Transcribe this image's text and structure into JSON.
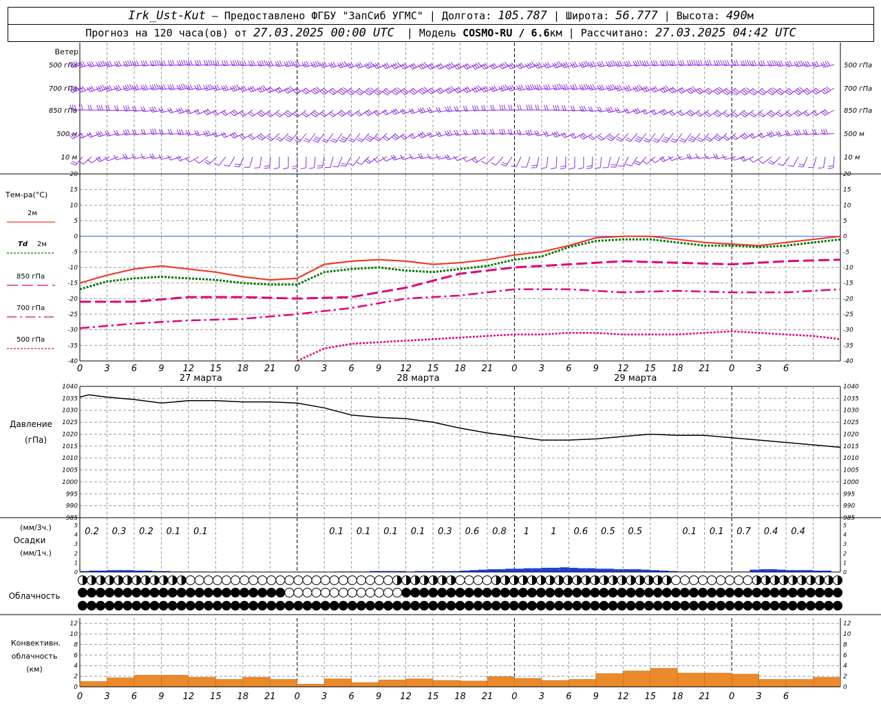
{
  "header": {
    "station": "Irk_Ust-Kut",
    "provided": "– Предоставлено ФГБУ \"ЗапСиб УГМС\"",
    "lon_label": "Долгота:",
    "lon": "105.787",
    "lat_label": "Широта:",
    "lat": "56.777",
    "alt_label": "Высота:",
    "alt": "490",
    "alt_unit": "м",
    "forecast_label": "Прогноз на 120 часа(ов) от",
    "forecast_from": "27.03.2025 00:00 UTC",
    "model_label": "Модель",
    "model": "COSMO-RU / 6.6",
    "model_unit": "км",
    "calc_label": "Рассчитано:",
    "calc_time": "27.03.2025 04:42 UTC"
  },
  "colors": {
    "t2m": "#ee3a2c",
    "td2m": "#007700",
    "t850": "#e0007a",
    "t700": "#e0007a",
    "t500": "#e0007a",
    "barb": "#8a2be2",
    "precip": "#1f3fd6",
    "conv": "#ea8a2a",
    "pressure": "#000000",
    "zero_line": "#3355ff",
    "grid": "#999999"
  },
  "hour_ticks": [
    "0",
    "3",
    "6",
    "9",
    "12",
    "15",
    "18",
    "21",
    "0",
    "3",
    "6",
    "9",
    "12",
    "15",
    "18",
    "21",
    "0",
    "3",
    "6",
    "9",
    "12",
    "15",
    "18",
    "21",
    "0",
    "3",
    "6"
  ],
  "day_labels": [
    "27 марта",
    "28 марта",
    "29 марта"
  ],
  "wind": {
    "title": "Ветер",
    "levels": [
      "500 гПа",
      "700 гПа",
      "850 гПа",
      "500 м",
      "10 м"
    ],
    "levels_right": [
      "500 гПа",
      "700 гПа",
      "850 гПа",
      "500 м",
      "10 м"
    ]
  },
  "temperature": {
    "title": "Тем-ра(°С)",
    "legend": [
      "2м",
      "Td 2м",
      "850 гПа",
      "700 гПа",
      "500 гПа"
    ]
  },
  "pressure_panel": {
    "title": "Давление",
    "unit": "(гПа)"
  },
  "precip_panel": {
    "unit3": "(мм/3ч.)",
    "title": "Осадки",
    "unit1": "(мм/1ч.)",
    "labels": [
      {
        "h": 3,
        "v": "0.2"
      },
      {
        "h": 6,
        "v": "0.3"
      },
      {
        "h": 9,
        "v": "0.2"
      },
      {
        "h": 12,
        "v": "0.1"
      },
      {
        "h": 15,
        "v": "0.1"
      },
      {
        "h": 30,
        "v": "0.1"
      },
      {
        "h": 33,
        "v": "0.1"
      },
      {
        "h": 36,
        "v": "0.1"
      },
      {
        "h": 39,
        "v": "0.1"
      },
      {
        "h": 42,
        "v": "0.3"
      },
      {
        "h": 45,
        "v": "0.6"
      },
      {
        "h": 48,
        "v": "0.8"
      },
      {
        "h": 51,
        "v": "1"
      },
      {
        "h": 54,
        "v": "1"
      },
      {
        "h": 57,
        "v": "0.6"
      },
      {
        "h": 60,
        "v": "0.5"
      },
      {
        "h": 63,
        "v": "0.5"
      },
      {
        "h": 69,
        "v": "0.1"
      },
      {
        "h": 72,
        "v": "0.1"
      },
      {
        "h": 75,
        "v": "0.7"
      },
      {
        "h": 78,
        "v": "0.4"
      },
      {
        "h": 81,
        "v": "0.4"
      }
    ]
  },
  "cloud_panel": {
    "title": "Облачность"
  },
  "conv_panel": {
    "title1": "Конвективн.",
    "title2": "облачность",
    "unit": "(км)"
  },
  "chart_data": [
    {
      "type": "line",
      "name": "temperature",
      "x_hours": [
        0,
        6,
        12,
        18,
        24,
        30,
        36,
        42,
        48,
        54,
        60,
        66,
        72,
        78,
        84
      ],
      "ylim": [
        -40,
        20
      ],
      "yticks": [
        20,
        15,
        10,
        5,
        0,
        -5,
        -10,
        -15,
        -20,
        -25,
        -30,
        -35,
        -40
      ],
      "series": [
        {
          "name": "2м",
          "key": "t2m",
          "x": [
            0,
            3,
            6,
            9,
            12,
            15,
            18,
            21,
            24,
            27,
            30,
            33,
            36,
            39,
            42,
            45,
            48,
            51,
            54,
            57,
            60,
            63,
            66,
            69,
            72,
            75,
            78,
            81,
            84
          ],
          "values": [
            -15,
            -12.5,
            -10.5,
            -9.5,
            -10.5,
            -11.5,
            -13,
            -14,
            -13.5,
            -9,
            -8,
            -7.5,
            -8,
            -9,
            -8.5,
            -7.5,
            -6,
            -5,
            -3,
            -0.5,
            0,
            0,
            -1,
            -2,
            -2.5,
            -3,
            -2,
            -1,
            0
          ]
        },
        {
          "name": "Td 2м",
          "key": "td2m",
          "x": [
            0,
            3,
            6,
            9,
            12,
            15,
            18,
            21,
            24,
            27,
            30,
            33,
            36,
            39,
            42,
            45,
            48,
            51,
            54,
            57,
            60,
            63,
            66,
            69,
            72,
            75,
            78,
            81,
            84
          ],
          "values": [
            -17,
            -14.5,
            -13.5,
            -13,
            -13.5,
            -14,
            -15,
            -15.5,
            -15.5,
            -11.5,
            -10.5,
            -10,
            -11,
            -11.5,
            -10.5,
            -9.5,
            -7.5,
            -6.5,
            -3.5,
            -1.5,
            -1,
            -1,
            -2,
            -3,
            -3,
            -3.5,
            -3,
            -2,
            -1
          ]
        },
        {
          "name": "850 гПа",
          "key": "t850",
          "x": [
            0,
            6,
            12,
            18,
            24,
            30,
            36,
            42,
            48,
            54,
            60,
            66,
            72,
            78,
            84
          ],
          "values": [
            -21,
            -21,
            -19.5,
            -19.5,
            -20,
            -19.5,
            -16.5,
            -12,
            -10,
            -9,
            -8,
            -8.5,
            -9,
            -8,
            -7.5
          ]
        },
        {
          "name": "700 гПа",
          "key": "t700",
          "x": [
            0,
            6,
            12,
            18,
            24,
            30,
            36,
            42,
            48,
            54,
            60,
            66,
            72,
            78,
            84
          ],
          "values": [
            -29.5,
            -28,
            -27,
            -26.5,
            -25,
            -23,
            -20,
            -19,
            -17,
            -17,
            -18,
            -17.5,
            -18,
            -18,
            -17
          ]
        },
        {
          "name": "500 гПа",
          "key": "t500",
          "x": [
            24,
            27,
            30,
            33,
            36,
            39,
            42,
            45,
            48,
            51,
            54,
            57,
            60,
            63,
            66,
            69,
            72,
            75,
            78,
            81,
            84
          ],
          "values": [
            -40,
            -36,
            -34.5,
            -34,
            -33.5,
            -33,
            -32.5,
            -32,
            -31.5,
            -31.5,
            -31,
            -31,
            -31.5,
            -31.5,
            -31.5,
            -31,
            -30.5,
            -31,
            -31.5,
            -32,
            -33
          ]
        }
      ]
    },
    {
      "type": "line",
      "name": "pressure",
      "ylim": [
        985,
        1040
      ],
      "yticks": [
        1040,
        1035,
        1030,
        1025,
        1020,
        1015,
        1010,
        1005,
        1000,
        995,
        990,
        985
      ],
      "x": [
        0,
        1,
        3,
        6,
        9,
        12,
        15,
        18,
        21,
        24,
        27,
        30,
        33,
        36,
        39,
        42,
        45,
        48,
        51,
        54,
        57,
        60,
        63,
        66,
        69,
        72,
        75,
        78,
        81,
        84
      ],
      "values": [
        1035.5,
        1036.5,
        1035.5,
        1034.5,
        1033,
        1034,
        1034,
        1033.5,
        1033.5,
        1033,
        1031,
        1028,
        1027,
        1026.5,
        1025,
        1022.5,
        1020.5,
        1019,
        1017.5,
        1017.5,
        1018,
        1019,
        1020,
        1019.5,
        1019.5,
        1018.5,
        1017.5,
        1016.5,
        1015.5,
        1014.5
      ]
    },
    {
      "type": "bar",
      "name": "precipitation_1h",
      "unit": "мм/1ч.",
      "ylim": [
        0,
        5
      ],
      "yticks": [
        5,
        4,
        3,
        2,
        1,
        0
      ],
      "x": [
        1,
        2,
        3,
        4,
        5,
        6,
        7,
        8,
        9,
        10,
        11,
        12,
        13,
        14,
        29,
        30,
        31,
        32,
        33,
        34,
        35,
        36,
        37,
        38,
        39,
        40,
        41,
        42,
        43,
        44,
        45,
        46,
        47,
        48,
        49,
        50,
        51,
        52,
        53,
        54,
        55,
        56,
        57,
        58,
        59,
        60,
        61,
        62,
        63,
        64,
        65,
        66,
        67,
        68,
        69,
        70,
        71,
        72,
        73,
        74,
        75,
        76,
        77,
        78,
        79,
        80,
        81,
        82,
        83
      ],
      "values": [
        0.1,
        0.15,
        0.15,
        0.2,
        0.2,
        0.2,
        0.15,
        0.15,
        0.1,
        0.1,
        0.05,
        0.05,
        0.05,
        0.05,
        0.05,
        0.05,
        0.05,
        0.05,
        0.1,
        0.1,
        0.1,
        0.1,
        0.05,
        0.1,
        0.1,
        0.1,
        0.1,
        0.1,
        0.15,
        0.2,
        0.25,
        0.3,
        0.3,
        0.35,
        0.35,
        0.4,
        0.4,
        0.45,
        0.45,
        0.5,
        0.45,
        0.4,
        0.4,
        0.35,
        0.35,
        0.3,
        0.3,
        0.3,
        0.25,
        0.2,
        0.15,
        0.1,
        0.05,
        0.05,
        0.05,
        0.05,
        0.05,
        0.05,
        0.05,
        0.05,
        0.25,
        0.3,
        0.3,
        0.25,
        0.2,
        0.2,
        0.2,
        0.15,
        0.15
      ]
    },
    {
      "type": "bar",
      "name": "convective_cloud",
      "unit": "км",
      "ylim": [
        0,
        13
      ],
      "yticks": [
        12,
        10,
        8,
        6,
        4,
        2,
        0
      ],
      "x": [
        0,
        3,
        6,
        9,
        12,
        15,
        18,
        21,
        24,
        27,
        30,
        33,
        36,
        39,
        42,
        45,
        48,
        51,
        54,
        57,
        60,
        63,
        66,
        69,
        72,
        75,
        78,
        81
      ],
      "values": [
        1,
        1.7,
        2.2,
        2.2,
        1.8,
        1.4,
        1.8,
        1.4,
        0.5,
        1.5,
        0.8,
        1.3,
        1.5,
        1.2,
        1.1,
        1.9,
        1.6,
        1.2,
        1.4,
        2.5,
        3,
        3.5,
        2.6,
        2.6,
        2.4,
        1.4,
        1.4,
        1.8
      ]
    }
  ]
}
